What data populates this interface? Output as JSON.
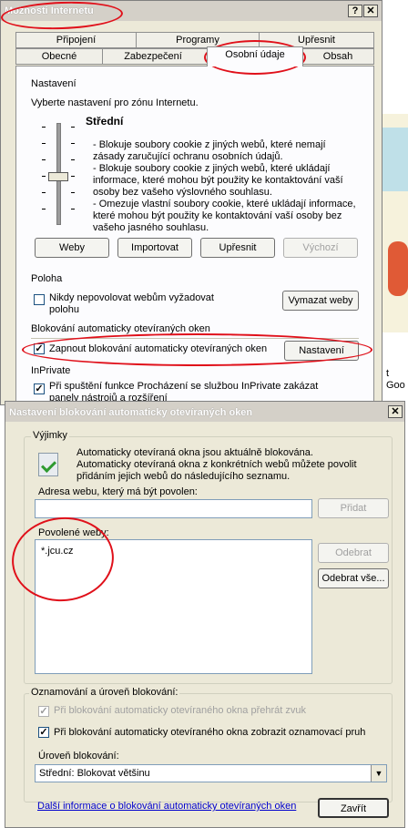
{
  "main_dialog": {
    "title": "Možnosti Internetu",
    "help_btn": "?",
    "close_btn": "✕",
    "tabs_row1": [
      "Připojení",
      "Programy",
      "Upřesnit"
    ],
    "tabs_row2": [
      "Obecné",
      "Zabezpečení",
      "Osobní údaje",
      "Obsah"
    ],
    "settings": {
      "header": "Nastavení",
      "zone_text": "Vyberte nastavení pro zónu Internetu.",
      "level": "Střední",
      "desc": [
        "- Blokuje soubory cookie z jiných webů, které nemají zásady zaručující ochranu osobních údajů.",
        "- Blokuje soubory cookie z jiných webů, které ukládají informace, které mohou být použity ke kontaktování vaší osoby bez vašeho výslovného souhlasu.",
        "- Omezuje vlastní soubory cookie, které ukládají informace, které mohou být použity ke kontaktování vaší osoby bez vašeho jasného souhlasu."
      ],
      "buttons": [
        "Weby",
        "Importovat",
        "Upřesnit",
        "Výchozí"
      ]
    },
    "location": {
      "header": "Poloha",
      "checkbox": "Nikdy nepovolovat webům vyžadovat polohu",
      "clear_btn": "Vymazat weby"
    },
    "popup": {
      "header": "Blokování automaticky otevíraných oken",
      "checkbox": "Zapnout blokování automaticky otevíraných oken",
      "settings_btn": "Nastavení"
    },
    "inprivate": {
      "header": "InPrivate",
      "checkbox": "Při spuštění funkce Procházení se službou InPrivate zakázat panely nástrojů a rozšíření"
    }
  },
  "background": {
    "fragment_text": "t Goo"
  },
  "popup_dialog": {
    "title": "Nastavení blokování automaticky otevíraných oken",
    "close_btn": "✕",
    "exceptions_label": "Výjimky",
    "info_text": "Automaticky otevíraná okna jsou aktuálně blokována. Automaticky otevíraná okna z konkrétních webů můžete povolit přidáním jejich webů do následujícího seznamu.",
    "address_label": "Adresa webu, který má být povolen:",
    "address_value": "",
    "add_btn": "Přidat",
    "allowed_label": "Povolené weby:",
    "allowed_sites": [
      "*.jcu.cz"
    ],
    "remove_btn": "Odebrat",
    "remove_all_btn": "Odebrat vše...",
    "notif_label": "Oznamování a úroveň blokování:",
    "sound_checkbox": "Při blokování automaticky otevíraného okna přehrát zvuk",
    "bar_checkbox": "Při blokování automaticky otevíraného okna zobrazit oznamovací pruh",
    "level_label": "Úroveň blokování:",
    "level_value": "Střední: Blokovat většinu",
    "more_info_link": "Další informace o blokování automaticky otevíraných oken",
    "close_btn_label": "Zavřít"
  },
  "colors": {
    "annotation": "#e0101a",
    "link": "#0000cc"
  }
}
